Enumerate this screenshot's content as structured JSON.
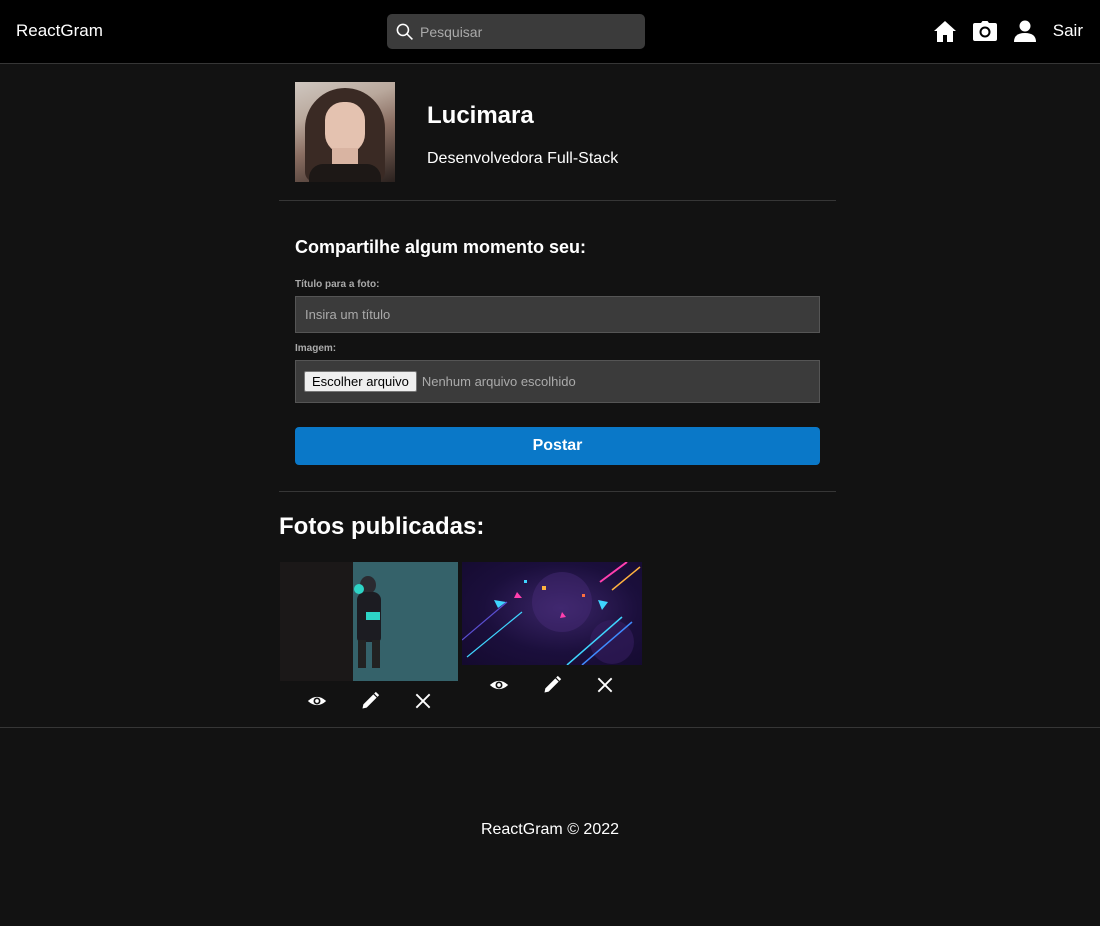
{
  "navbar": {
    "brand": "ReactGram",
    "search_placeholder": "Pesquisar",
    "icons": [
      "home-icon",
      "camera-icon",
      "user-icon"
    ],
    "logout_label": "Sair"
  },
  "profile": {
    "name": "Lucimara",
    "bio": "Desenvolvedora Full-Stack"
  },
  "share_form": {
    "heading": "Compartilhe algum momento seu:",
    "title_label": "Título para a foto:",
    "title_placeholder": "Insira um título",
    "image_label": "Imagem:",
    "file_button": "Escolher arquivo",
    "file_status": "Nenhum arquivo escolhido",
    "submit_label": "Postar"
  },
  "photos": {
    "heading": "Fotos publicadas:",
    "items": [
      {
        "actions": [
          "eye-icon",
          "pencil-icon",
          "close-icon"
        ]
      },
      {
        "actions": [
          "eye-icon",
          "pencil-icon",
          "close-icon"
        ]
      }
    ]
  },
  "footer": {
    "text": "ReactGram © 2022"
  },
  "colors": {
    "background": "#121212",
    "navbar": "#000000",
    "input": "#3b3b3b",
    "accent": "#0a78c8"
  }
}
